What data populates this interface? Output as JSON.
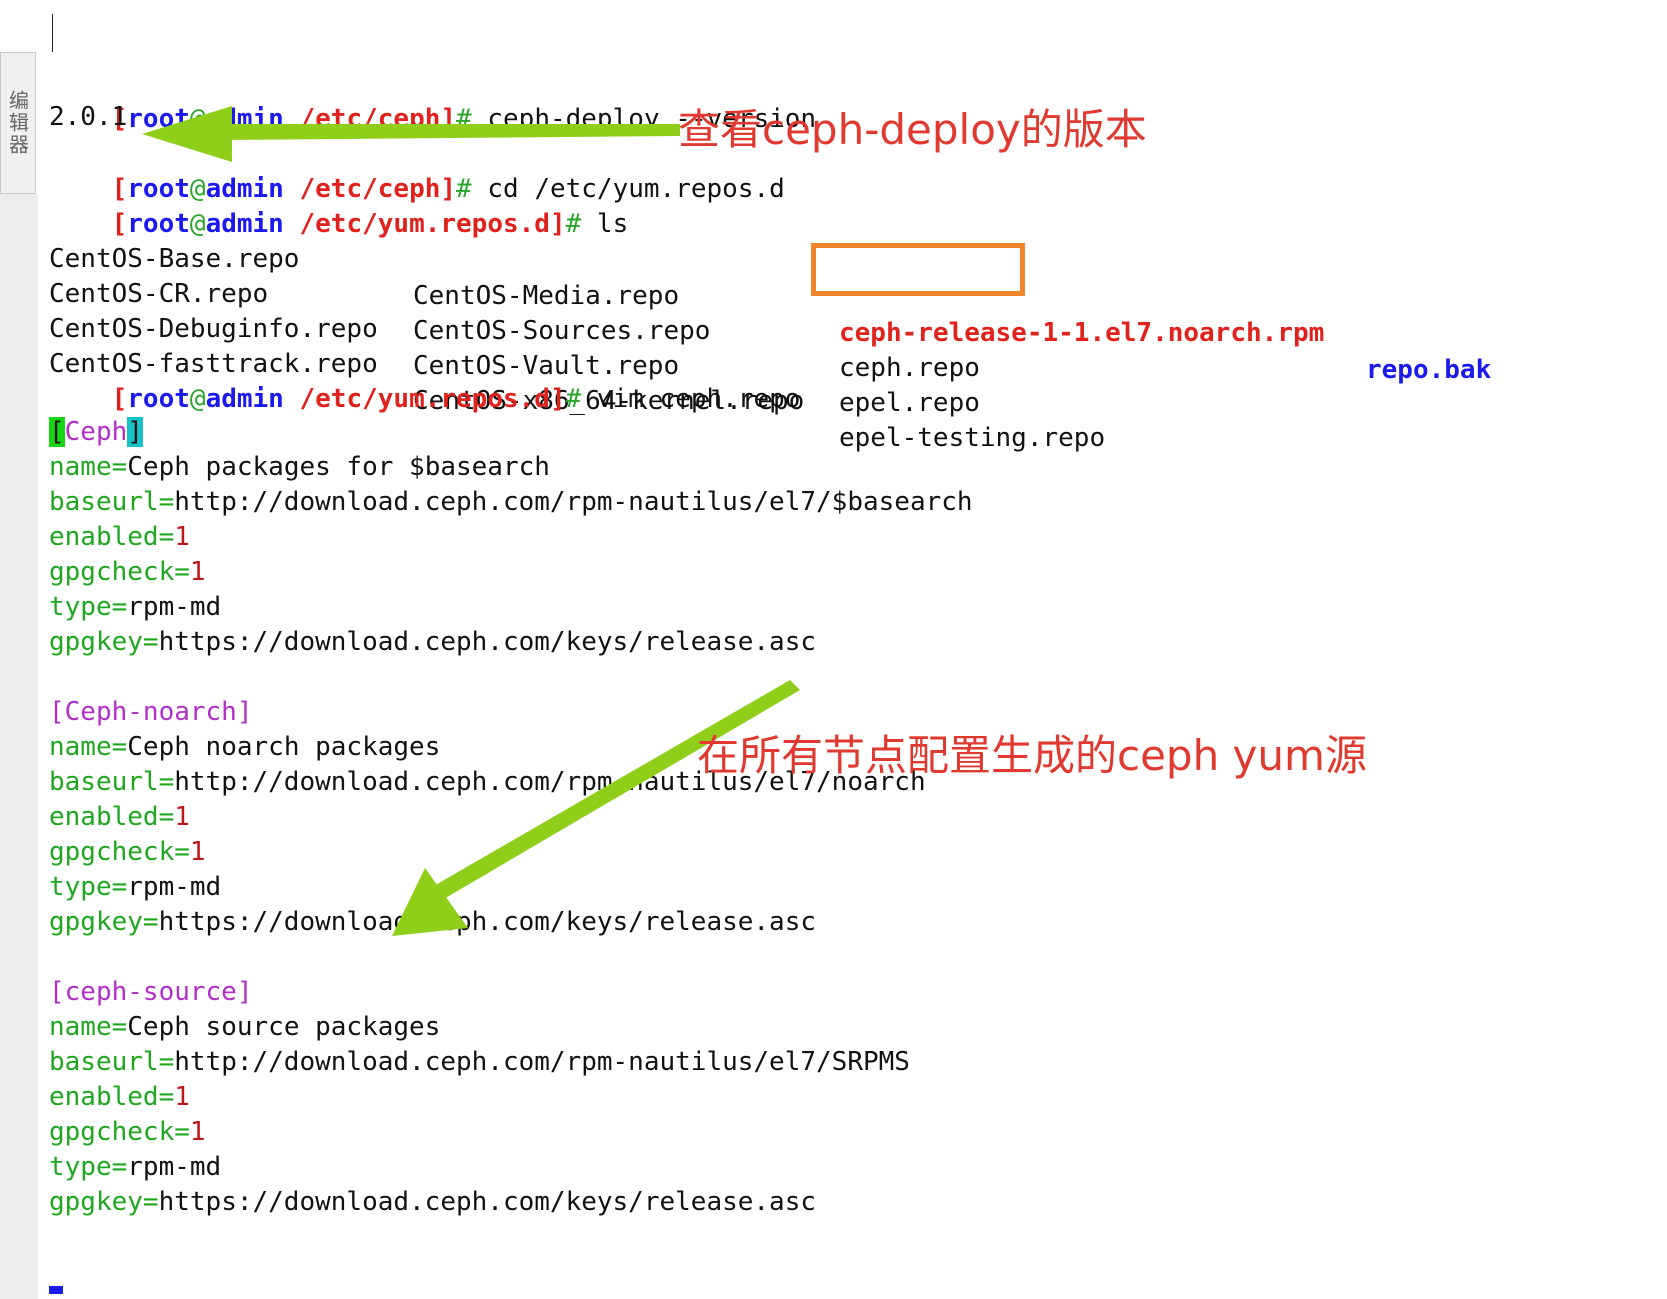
{
  "sidebar": {
    "label": "编辑器"
  },
  "prompt": {
    "open": "[",
    "user": "root",
    "at": "@",
    "host": "admin",
    "close": "]",
    "hash": "#"
  },
  "terminal": {
    "cmd1": {
      "path": "/etc/ceph",
      "command": "ceph-deploy --version"
    },
    "output1": "2.0.1",
    "cmd2": {
      "path": "/etc/ceph",
      "command": "cd /etc/yum.repos.d"
    },
    "cmd3": {
      "path": "/etc/yum.repos.d",
      "command": "ls"
    },
    "ls_rows": [
      [
        "CentOS-Base.repo",
        "CentOS-Media.repo",
        "ceph-release-1-1.el7.noarch.rpm",
        "repo.bak"
      ],
      [
        "CentOS-CR.repo",
        "CentOS-Sources.repo",
        "ceph.repo",
        ""
      ],
      [
        "CentOS-Debuginfo.repo",
        "CentOS-Vault.repo",
        "epel.repo",
        ""
      ],
      [
        "CentOS-fasttrack.repo",
        "CentOS-x86_64-kernel.repo",
        "epel-testing.repo",
        ""
      ]
    ],
    "cmd4": {
      "path": "/etc/yum.repos.d",
      "command": "vim ceph.repo"
    }
  },
  "repo": {
    "s1_open": "[",
    "s1_name": "Ceph",
    "s1_close": "]",
    "s1": {
      "name_key": "name=",
      "name_val": "Ceph packages for $basearch",
      "baseurl_key": "baseurl=",
      "baseurl_val": "http://download.ceph.com/rpm-nautilus/el7/$basearch",
      "enabled_key": "enabled=",
      "enabled_val": "1",
      "gpgcheck_key": "gpgcheck=",
      "gpgcheck_val": "1",
      "type_key": "type=",
      "type_val": "rpm-md",
      "gpgkey_key": "gpgkey=",
      "gpgkey_val": "https://download.ceph.com/keys/release.asc"
    },
    "s2_header": "[Ceph-noarch]",
    "s2": {
      "name_key": "name=",
      "name_val": "Ceph noarch packages",
      "baseurl_key": "baseurl=",
      "baseurl_val": "http://download.ceph.com/rpm-nautilus/el7/noarch",
      "enabled_key": "enabled=",
      "enabled_val": "1",
      "gpgcheck_key": "gpgcheck=",
      "gpgcheck_val": "1",
      "type_key": "type=",
      "type_val": "rpm-md",
      "gpgkey_key": "gpgkey=",
      "gpgkey_val": "https://download.ceph.com/keys/release.asc"
    },
    "s3_header": "[ceph-source]",
    "s3": {
      "name_key": "name=",
      "name_val": "Ceph source packages",
      "baseurl_key": "baseurl=",
      "baseurl_val": "http://download.ceph.com/rpm-nautilus/el7/SRPMS",
      "enabled_key": "enabled=",
      "enabled_val": "1",
      "gpgcheck_key": "gpgcheck=",
      "gpgcheck_val": "1",
      "type_key": "type=",
      "type_val": "rpm-md",
      "gpgkey_key": "gpgkey=",
      "gpgkey_val": "https://download.ceph.com/keys/release.asc"
    }
  },
  "annotations": {
    "note1": "查看ceph-deploy的版本",
    "note2": "在所有节点配置生成的ceph yum源"
  },
  "colors": {
    "prompt_user": "#1a1aef",
    "prompt_path": "#e0221c",
    "config_key": "#1fa81f",
    "section_header": "#b22fc8",
    "highlight_box": "#f0852a",
    "arrow": "#8fcf1a",
    "annotation_text": "#e03a30"
  }
}
